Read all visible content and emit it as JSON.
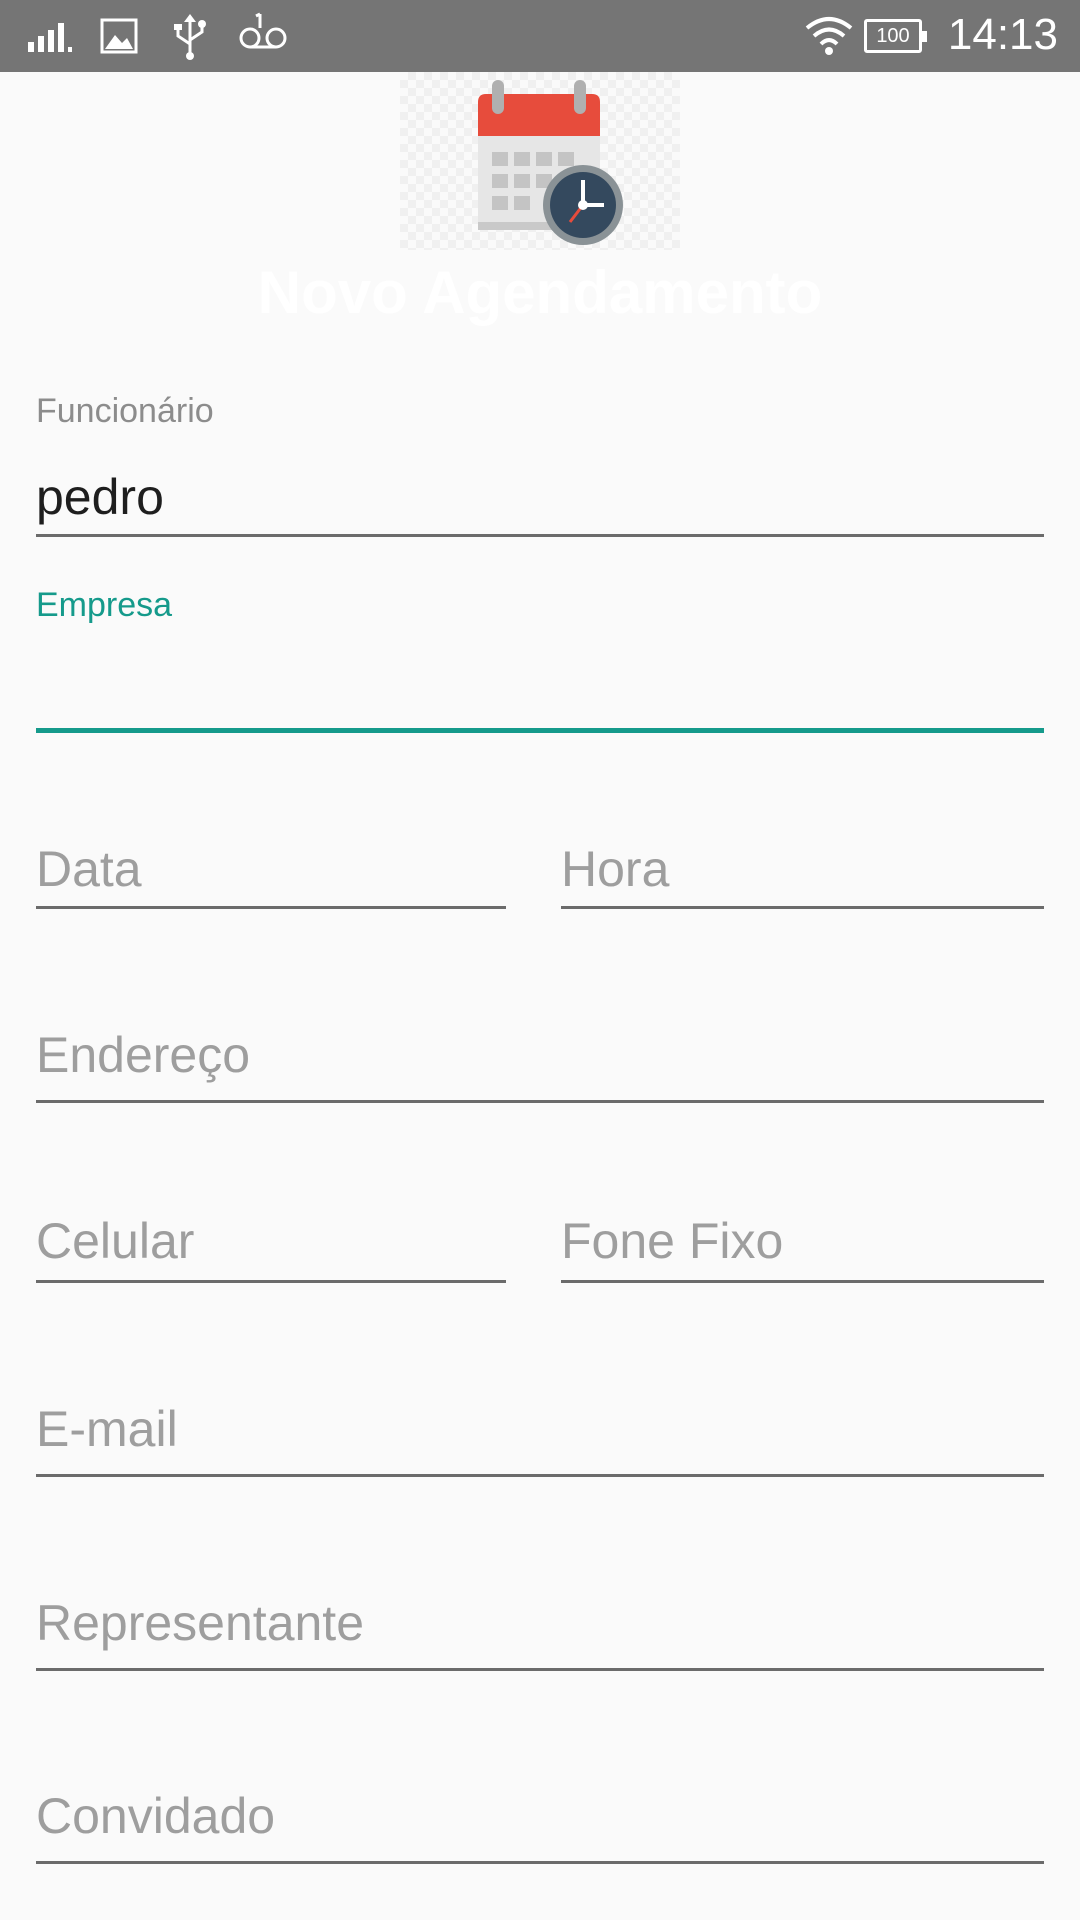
{
  "status_bar": {
    "time": "14:13",
    "battery": "100",
    "icons": [
      "signal-icon",
      "image-notification-icon",
      "usb-icon",
      "voicemail-icon",
      "wifi-icon",
      "battery-icon"
    ]
  },
  "header": {
    "logo_icon": "calendar-clock-icon",
    "title": "Novo Agendamento"
  },
  "form": {
    "funcionario": {
      "label": "Funcionário",
      "value": "pedro"
    },
    "empresa": {
      "label": "Empresa",
      "value": ""
    },
    "data": {
      "placeholder": "Data"
    },
    "hora": {
      "placeholder": "Hora"
    },
    "endereco": {
      "placeholder": "Endereço"
    },
    "celular": {
      "placeholder": "Celular"
    },
    "fone_fixo": {
      "placeholder": "Fone Fixo"
    },
    "email": {
      "placeholder": "E-mail"
    },
    "representante": {
      "placeholder": "Representante"
    },
    "convidado": {
      "placeholder": "Convidado"
    }
  },
  "colors": {
    "status_bar": "#757575",
    "background": "#fafafa",
    "accent": "#159a8b",
    "underline": "#6b6b6b",
    "hint": "#9e9e9e"
  }
}
